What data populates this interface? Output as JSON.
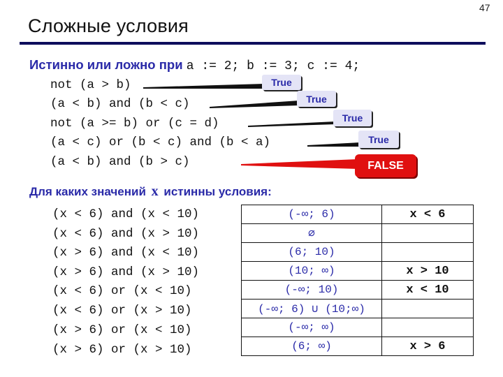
{
  "slide": {
    "page_number": "47",
    "title": "Сложные условия"
  },
  "question1": {
    "prompt": "Истинно или ложно при",
    "assignments": "a := 2; b := 3; c := 4;",
    "items": [
      {
        "expression": "not (a > b)",
        "answer": "True"
      },
      {
        "expression": "(a < b) and (b < c)",
        "answer": "True"
      },
      {
        "expression": "not (a >= b) or (c = d)",
        "answer": "True"
      },
      {
        "expression": "(a < c) or (b < c) and (b < a)",
        "answer": "True"
      },
      {
        "expression": "(a < b) and (b > c)",
        "answer": "FALSE"
      }
    ],
    "colors": {
      "true_bg": "#e4e4f6",
      "true_text": "#2a2aa8",
      "false_bg": "#e01010",
      "false_text": "#ffffff"
    }
  },
  "question2": {
    "prompt_before": "Для каких значений",
    "variable": "x",
    "prompt_after": "истинны условия:",
    "rows": [
      {
        "condition": "(x < 6) and (x < 10)",
        "interval": "(-∞; 6)",
        "simplified": "x < 6"
      },
      {
        "condition": "(x < 6) and (x > 10)",
        "interval": "∅",
        "simplified": ""
      },
      {
        "condition": "(x > 6) and (x < 10)",
        "interval": "(6; 10)",
        "simplified": ""
      },
      {
        "condition": "(x > 6) and (x > 10)",
        "interval": "(10; ∞)",
        "simplified": "x > 10"
      },
      {
        "condition": "(x < 6) or (x < 10)",
        "interval": "(-∞; 10)",
        "simplified": "x < 10"
      },
      {
        "condition": "(x < 6) or (x > 10)",
        "interval": "(-∞; 6) ∪ (10;∞)",
        "simplified": ""
      },
      {
        "condition": "(x > 6) or (x < 10)",
        "interval": "(-∞; ∞)",
        "simplified": ""
      },
      {
        "condition": "(x > 6) or (x > 10)",
        "interval": "(6; ∞)",
        "simplified": "x > 6"
      }
    ]
  }
}
